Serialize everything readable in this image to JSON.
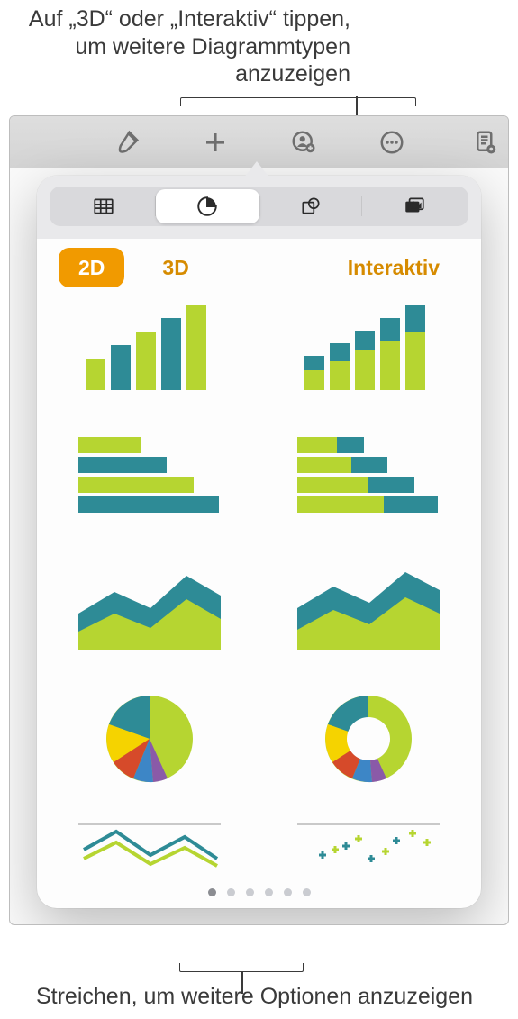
{
  "callouts": {
    "top": "Auf „3D“ oder „Interaktiv“ tippen, um weitere Diagrammtypen anzuzeigen",
    "bottom": "Streichen, um weitere Optionen anzuzeigen"
  },
  "toolbar": {
    "icons": [
      "brush-icon",
      "plus-icon",
      "collaborate-icon",
      "more-icon",
      "document-icon"
    ]
  },
  "insert_categories": {
    "items": [
      {
        "name": "tables",
        "active": false
      },
      {
        "name": "charts",
        "active": true
      },
      {
        "name": "shapes",
        "active": false
      },
      {
        "name": "media",
        "active": false
      }
    ]
  },
  "chart_type_tabs": {
    "items": [
      {
        "key": "2d",
        "label": "2D",
        "active": true
      },
      {
        "key": "3d",
        "label": "3D",
        "active": false
      },
      {
        "key": "interactive",
        "label": "Interaktiv",
        "active": false
      }
    ]
  },
  "chart_templates": [
    {
      "name": "column-chart",
      "type": "column"
    },
    {
      "name": "stacked-column-chart",
      "type": "column-stacked"
    },
    {
      "name": "bar-chart",
      "type": "bar"
    },
    {
      "name": "stacked-bar-chart",
      "type": "bar-stacked"
    },
    {
      "name": "area-chart",
      "type": "area"
    },
    {
      "name": "stacked-area-chart",
      "type": "area-stacked"
    },
    {
      "name": "pie-chart",
      "type": "pie"
    },
    {
      "name": "donut-chart",
      "type": "donut"
    },
    {
      "name": "line-chart",
      "type": "line"
    },
    {
      "name": "scatter-chart",
      "type": "scatter"
    }
  ],
  "pagination": {
    "page_count": 6,
    "current_page": 1
  },
  "colors": {
    "accent": "#f19a00",
    "chart_green": "#b6d531",
    "chart_teal": "#2e8b96"
  }
}
